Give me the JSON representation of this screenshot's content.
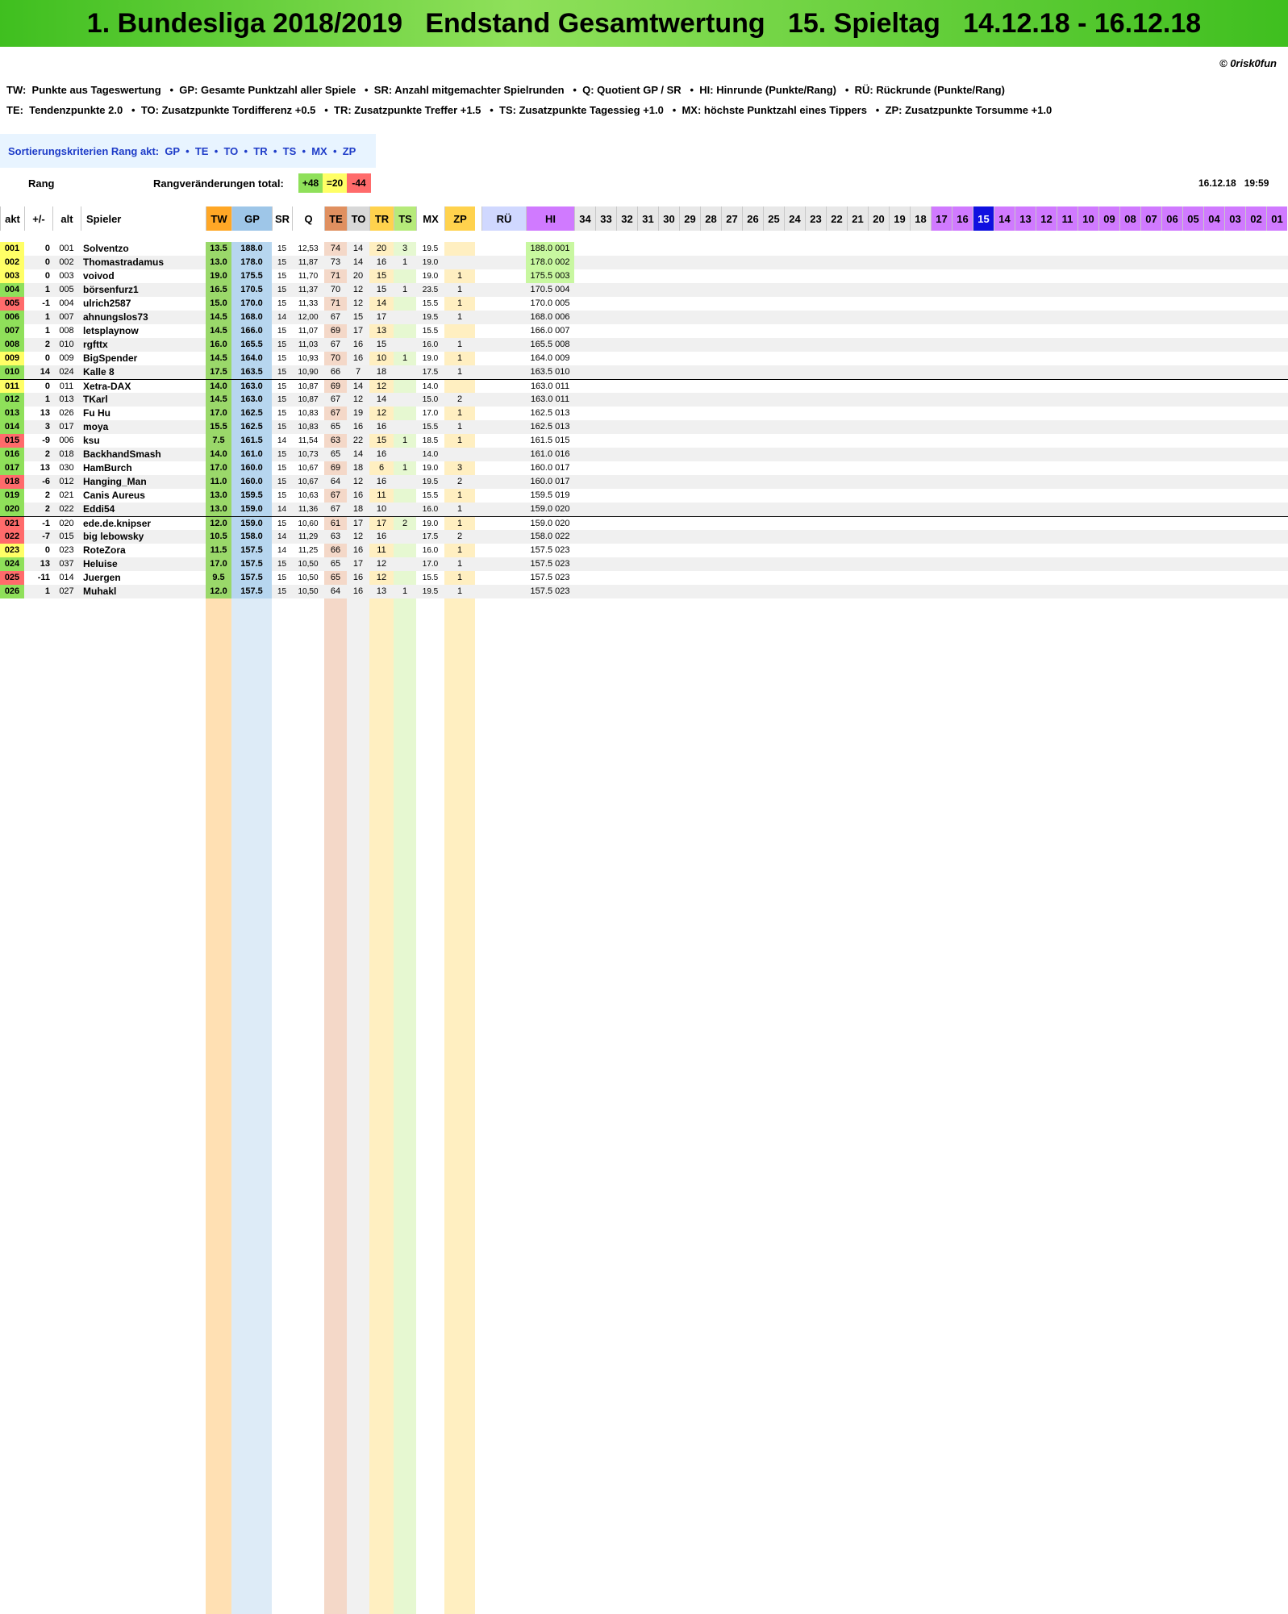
{
  "title": "1. Bundesliga 2018/2019   Endstand Gesamtwertung   15. Spieltag   14.12.18 - 16.12.18",
  "copyright": "© 0risk0fun",
  "legend_line1": "TW:  Punkte aus Tageswertung   •  GP: Gesamte Punktzahl aller Spiele   •  SR: Anzahl mitgemachter Spielrunden   •  Q: Quotient GP / SR   •  HI: Hinrunde (Punkte/Rang)   •  RÜ: Rückrunde (Punkte/Rang)",
  "legend_line2": "TE:  Tendenzpunkte 2.0   •  TO: Zusatzpunkte Tordifferenz +0.5   •  TR: Zusatzpunkte Treffer +1.5   •  TS: Zusatzpunkte Tagessieg +1.0   •  MX: höchste Punktzahl eines Tippers   •  ZP: Zusatzpunkte Torsumme +1.0",
  "sort_label": "Sortierungskriterien Rang akt:  GP  •  TE  •  TO  •  TR  •  TS  •  MX  •  ZP",
  "rang_label": "Rang",
  "rangchange_label": "Rangveränderungen total:",
  "rangchange": {
    "up": "+48",
    "same": "=20",
    "down": "-44"
  },
  "date_time": "16.12.18   19:59",
  "colors": {
    "banner": "#3fbf1f",
    "up": "#8fe05a",
    "same": "#ffff66",
    "down": "#ff6b6b",
    "tw": "#ffa726",
    "gp": "#9ec6e8",
    "te": "#e09060",
    "hi": "#d07aff",
    "current_round": "#1010e0"
  },
  "headers": {
    "akt": "akt",
    "pm": "+/-",
    "alt": "alt",
    "spieler": "Spieler",
    "tw": "TW",
    "gp": "GP",
    "sr": "SR",
    "q": "Q",
    "te": "TE",
    "to": "TO",
    "tr": "TR",
    "ts": "TS",
    "mx": "MX",
    "zp": "ZP",
    "ru": "RÜ",
    "hi": "HI",
    "rounds": [
      "34",
      "33",
      "32",
      "31",
      "30",
      "29",
      "28",
      "27",
      "26",
      "25",
      "24",
      "23",
      "22",
      "21",
      "20",
      "19",
      "18",
      "17",
      "16",
      "15",
      "14",
      "13",
      "12",
      "11",
      "10",
      "09",
      "08",
      "07",
      "06",
      "05",
      "04",
      "03",
      "02",
      "01"
    ]
  },
  "players": [
    {
      "akt": "001",
      "pm": "0",
      "alt": "001",
      "name": "Solventzo",
      "tw": "13.5",
      "gp": "188.0",
      "sr": "15",
      "q": "12,53",
      "te": "74",
      "to": "14",
      "tr": "20",
      "ts": "3",
      "mx": "19.5",
      "zp": "",
      "hi": "188.0  001"
    },
    {
      "akt": "002",
      "pm": "0",
      "alt": "002",
      "name": "Thomastradamus",
      "tw": "13.0",
      "gp": "178.0",
      "sr": "15",
      "q": "11,87",
      "te": "73",
      "to": "14",
      "tr": "16",
      "ts": "1",
      "mx": "19.0",
      "zp": "",
      "hi": "178.0  002"
    },
    {
      "akt": "003",
      "pm": "0",
      "alt": "003",
      "name": "voivod",
      "tw": "19.0",
      "gp": "175.5",
      "sr": "15",
      "q": "11,70",
      "te": "71",
      "to": "20",
      "tr": "15",
      "ts": "",
      "mx": "19.0",
      "zp": "1",
      "hi": "175.5  003"
    },
    {
      "akt": "004",
      "pm": "1",
      "alt": "005",
      "name": "börsenfurz1",
      "tw": "16.5",
      "gp": "170.5",
      "sr": "15",
      "q": "11,37",
      "te": "70",
      "to": "12",
      "tr": "15",
      "ts": "1",
      "mx": "23.5",
      "zp": "1",
      "hi": "170.5  004"
    },
    {
      "akt": "005",
      "pm": "-1",
      "alt": "004",
      "name": "ulrich2587",
      "tw": "15.0",
      "gp": "170.0",
      "sr": "15",
      "q": "11,33",
      "te": "71",
      "to": "12",
      "tr": "14",
      "ts": "",
      "mx": "15.5",
      "zp": "1",
      "hi": "170.0  005"
    },
    {
      "akt": "006",
      "pm": "1",
      "alt": "007",
      "name": "ahnungslos73",
      "tw": "14.5",
      "gp": "168.0",
      "sr": "14",
      "q": "12,00",
      "te": "67",
      "to": "15",
      "tr": "17",
      "ts": "",
      "mx": "19.5",
      "zp": "1",
      "hi": "168.0  006"
    },
    {
      "akt": "007",
      "pm": "1",
      "alt": "008",
      "name": "letsplaynow",
      "tw": "14.5",
      "gp": "166.0",
      "sr": "15",
      "q": "11,07",
      "te": "69",
      "to": "17",
      "tr": "13",
      "ts": "",
      "mx": "15.5",
      "zp": "",
      "hi": "166.0  007"
    },
    {
      "akt": "008",
      "pm": "2",
      "alt": "010",
      "name": "rgfttx",
      "tw": "16.0",
      "gp": "165.5",
      "sr": "15",
      "q": "11,03",
      "te": "67",
      "to": "16",
      "tr": "15",
      "ts": "",
      "mx": "16.0",
      "zp": "1",
      "hi": "165.5  008"
    },
    {
      "akt": "009",
      "pm": "0",
      "alt": "009",
      "name": "BigSpender",
      "tw": "14.5",
      "gp": "164.0",
      "sr": "15",
      "q": "10,93",
      "te": "70",
      "to": "16",
      "tr": "10",
      "ts": "1",
      "mx": "19.0",
      "zp": "1",
      "hi": "164.0  009"
    },
    {
      "akt": "010",
      "pm": "14",
      "alt": "024",
      "name": "Kalle 8",
      "tw": "17.5",
      "gp": "163.5",
      "sr": "15",
      "q": "10,90",
      "te": "66",
      "to": "7",
      "tr": "18",
      "ts": "",
      "mx": "17.5",
      "zp": "1",
      "hi": "163.5  010"
    },
    {
      "akt": "011",
      "pm": "0",
      "alt": "011",
      "name": "Xetra-DAX",
      "tw": "14.0",
      "gp": "163.0",
      "sr": "15",
      "q": "10,87",
      "te": "69",
      "to": "14",
      "tr": "12",
      "ts": "",
      "mx": "14.0",
      "zp": "",
      "hi": "163.0  011"
    },
    {
      "akt": "012",
      "pm": "1",
      "alt": "013",
      "name": "TKarl",
      "tw": "14.5",
      "gp": "163.0",
      "sr": "15",
      "q": "10,87",
      "te": "67",
      "to": "12",
      "tr": "14",
      "ts": "",
      "mx": "15.0",
      "zp": "2",
      "hi": "163.0  011"
    },
    {
      "akt": "013",
      "pm": "13",
      "alt": "026",
      "name": "Fu Hu",
      "tw": "17.0",
      "gp": "162.5",
      "sr": "15",
      "q": "10,83",
      "te": "67",
      "to": "19",
      "tr": "12",
      "ts": "",
      "mx": "17.0",
      "zp": "1",
      "hi": "162.5  013"
    },
    {
      "akt": "014",
      "pm": "3",
      "alt": "017",
      "name": "moya",
      "tw": "15.5",
      "gp": "162.5",
      "sr": "15",
      "q": "10,83",
      "te": "65",
      "to": "16",
      "tr": "16",
      "ts": "",
      "mx": "15.5",
      "zp": "1",
      "hi": "162.5  013"
    },
    {
      "akt": "015",
      "pm": "-9",
      "alt": "006",
      "name": "ksu",
      "tw": "7.5",
      "gp": "161.5",
      "sr": "14",
      "q": "11,54",
      "te": "63",
      "to": "22",
      "tr": "15",
      "ts": "1",
      "mx": "18.5",
      "zp": "1",
      "hi": "161.5  015"
    },
    {
      "akt": "016",
      "pm": "2",
      "alt": "018",
      "name": "BackhandSmash",
      "tw": "14.0",
      "gp": "161.0",
      "sr": "15",
      "q": "10,73",
      "te": "65",
      "to": "14",
      "tr": "16",
      "ts": "",
      "mx": "14.0",
      "zp": "",
      "hi": "161.0  016"
    },
    {
      "akt": "017",
      "pm": "13",
      "alt": "030",
      "name": "HamBurch",
      "tw": "17.0",
      "gp": "160.0",
      "sr": "15",
      "q": "10,67",
      "te": "69",
      "to": "18",
      "tr": "6",
      "ts": "1",
      "mx": "19.0",
      "zp": "3",
      "hi": "160.0  017"
    },
    {
      "akt": "018",
      "pm": "-6",
      "alt": "012",
      "name": "Hanging_Man",
      "tw": "11.0",
      "gp": "160.0",
      "sr": "15",
      "q": "10,67",
      "te": "64",
      "to": "12",
      "tr": "16",
      "ts": "",
      "mx": "19.5",
      "zp": "2",
      "hi": "160.0  017"
    },
    {
      "akt": "019",
      "pm": "2",
      "alt": "021",
      "name": "Canis Aureus",
      "tw": "13.0",
      "gp": "159.5",
      "sr": "15",
      "q": "10,63",
      "te": "67",
      "to": "16",
      "tr": "11",
      "ts": "",
      "mx": "15.5",
      "zp": "1",
      "hi": "159.5  019"
    },
    {
      "akt": "020",
      "pm": "2",
      "alt": "022",
      "name": "Eddi54",
      "tw": "13.0",
      "gp": "159.0",
      "sr": "14",
      "q": "11,36",
      "te": "67",
      "to": "18",
      "tr": "10",
      "ts": "",
      "mx": "16.0",
      "zp": "1",
      "hi": "159.0  020"
    },
    {
      "akt": "021",
      "pm": "-1",
      "alt": "020",
      "name": "ede.de.knipser",
      "tw": "12.0",
      "gp": "159.0",
      "sr": "15",
      "q": "10,60",
      "te": "61",
      "to": "17",
      "tr": "17",
      "ts": "2",
      "mx": "19.0",
      "zp": "1",
      "hi": "159.0  020"
    },
    {
      "akt": "022",
      "pm": "-7",
      "alt": "015",
      "name": "big lebowsky",
      "tw": "10.5",
      "gp": "158.0",
      "sr": "14",
      "q": "11,29",
      "te": "63",
      "to": "12",
      "tr": "16",
      "ts": "",
      "mx": "17.5",
      "zp": "2",
      "hi": "158.0  022"
    },
    {
      "akt": "023",
      "pm": "0",
      "alt": "023",
      "name": "RoteZora",
      "tw": "11.5",
      "gp": "157.5",
      "sr": "14",
      "q": "11,25",
      "te": "66",
      "to": "16",
      "tr": "11",
      "ts": "",
      "mx": "16.0",
      "zp": "1",
      "hi": "157.5  023"
    },
    {
      "akt": "024",
      "pm": "13",
      "alt": "037",
      "name": "Heluise",
      "tw": "17.0",
      "gp": "157.5",
      "sr": "15",
      "q": "10,50",
      "te": "65",
      "to": "17",
      "tr": "12",
      "ts": "",
      "mx": "17.0",
      "zp": "1",
      "hi": "157.5  023"
    },
    {
      "akt": "025",
      "pm": "-11",
      "alt": "014",
      "name": "Juergen",
      "tw": "9.5",
      "gp": "157.5",
      "sr": "15",
      "q": "10,50",
      "te": "65",
      "to": "16",
      "tr": "12",
      "ts": "",
      "mx": "15.5",
      "zp": "1",
      "hi": "157.5  023"
    },
    {
      "akt": "026",
      "pm": "1",
      "alt": "027",
      "name": "Muhakl",
      "tw": "12.0",
      "gp": "157.5",
      "sr": "15",
      "q": "10,50",
      "te": "64",
      "to": "16",
      "tr": "13",
      "ts": "1",
      "mx": "19.5",
      "zp": "1",
      "hi": "157.5  023"
    }
  ]
}
